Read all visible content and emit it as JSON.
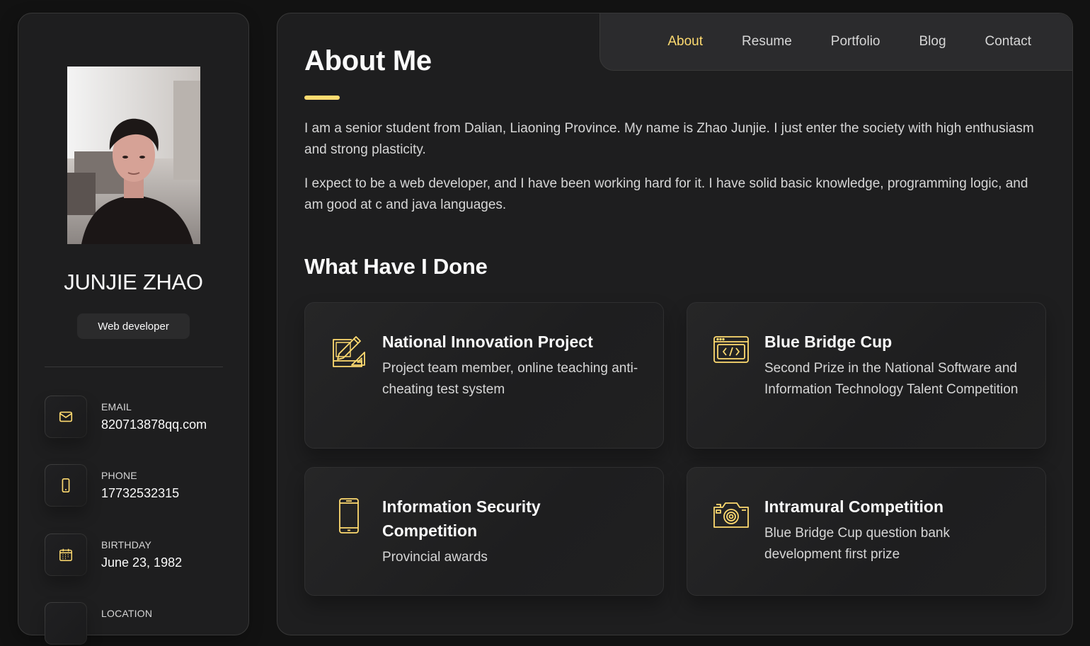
{
  "profile": {
    "name": "JUNJIE ZHAO",
    "role": "Web developer"
  },
  "contacts": [
    {
      "label": "EMAIL",
      "value": "820713878qq.com",
      "icon": "mail-icon"
    },
    {
      "label": "PHONE",
      "value": "17732532315",
      "icon": "phone-icon"
    },
    {
      "label": "BIRTHDAY",
      "value": "June 23, 1982",
      "icon": "calendar-icon"
    },
    {
      "label": "LOCATION",
      "value": "",
      "icon": "location-icon"
    }
  ],
  "nav": {
    "items": [
      "About",
      "Resume",
      "Portfolio",
      "Blog",
      "Contact"
    ],
    "active": "About"
  },
  "about": {
    "heading": "About Me",
    "paragraphs": [
      "I am a senior student from Dalian, Liaoning Province. My name is Zhao Junjie. I just enter the society with high enthusiasm and strong plasticity.",
      "I expect to be a web developer, and I have been working hard for it. I have solid basic knowledge, programming logic, and am good at c and java languages."
    ]
  },
  "done": {
    "heading": "What Have I Done",
    "cards": [
      {
        "title": "National Innovation Project",
        "text": "Project team member, online teaching anti-cheating test system",
        "icon": "design-tools-icon"
      },
      {
        "title": "Blue Bridge Cup",
        "text": "Second Prize in the National Software and Information Technology Talent Competition",
        "icon": "code-window-icon"
      },
      {
        "title": "Information Security Competition",
        "text": "Provincial awards",
        "icon": "smartphone-icon"
      },
      {
        "title": "Intramural Competition",
        "text": "Blue Bridge Cup question bank development first prize",
        "icon": "camera-icon"
      }
    ]
  },
  "colors": {
    "accent": "#ffdb70",
    "background": "#121212",
    "panel": "#1e1e1f",
    "text": "#d6d6d6"
  }
}
